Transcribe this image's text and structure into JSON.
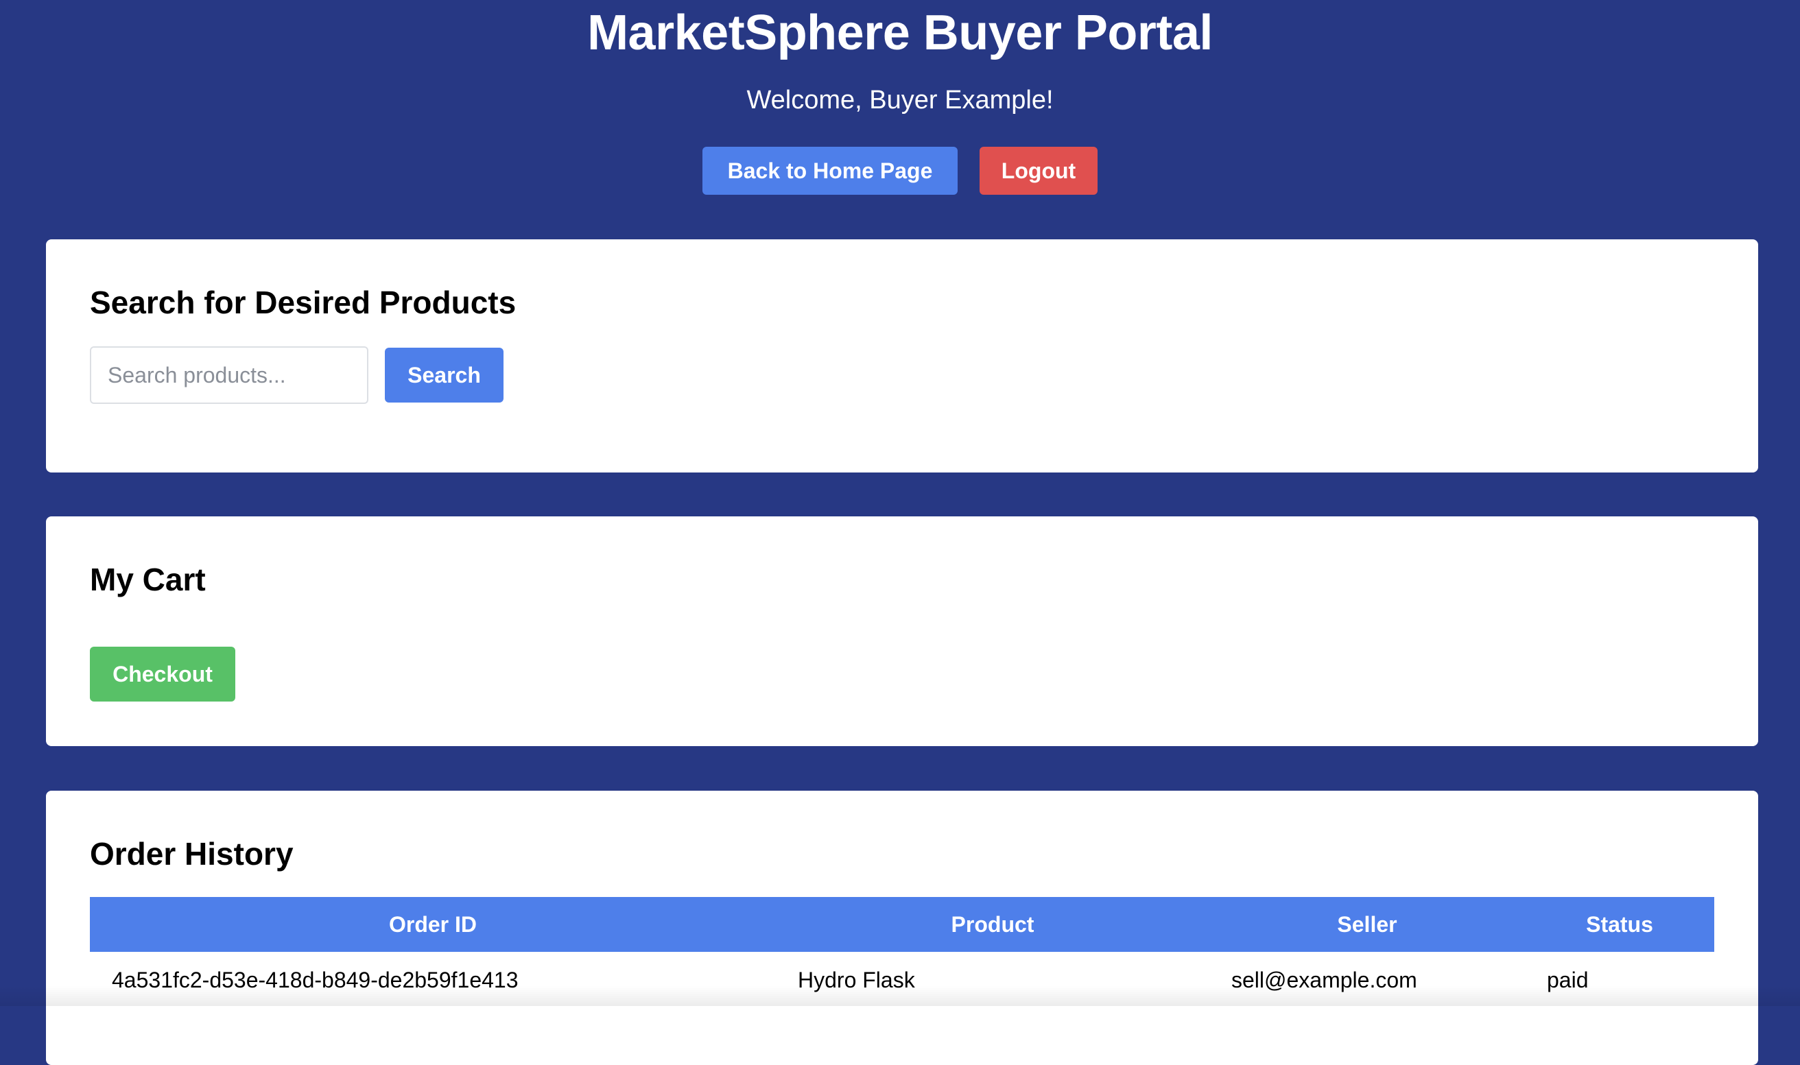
{
  "header": {
    "title": "MarketSphere Buyer Portal",
    "welcome": "Welcome, Buyer Example!",
    "home_button": "Back to Home Page",
    "logout_button": "Logout"
  },
  "search": {
    "title": "Search for Desired Products",
    "placeholder": "Search products...",
    "button": "Search"
  },
  "cart": {
    "title": "My Cart",
    "checkout_button": "Checkout"
  },
  "orders": {
    "title": "Order History",
    "columns": [
      "Order ID",
      "Product",
      "Seller",
      "Status"
    ],
    "rows": [
      {
        "order_id": "4a531fc2-d53e-418d-b849-de2b59f1e413",
        "product": "Hydro Flask",
        "seller": "sell@example.com",
        "status": "paid"
      }
    ]
  },
  "colors": {
    "background": "#273884",
    "primary": "#4e7fea",
    "danger": "#e0504f",
    "success": "#58c167"
  }
}
